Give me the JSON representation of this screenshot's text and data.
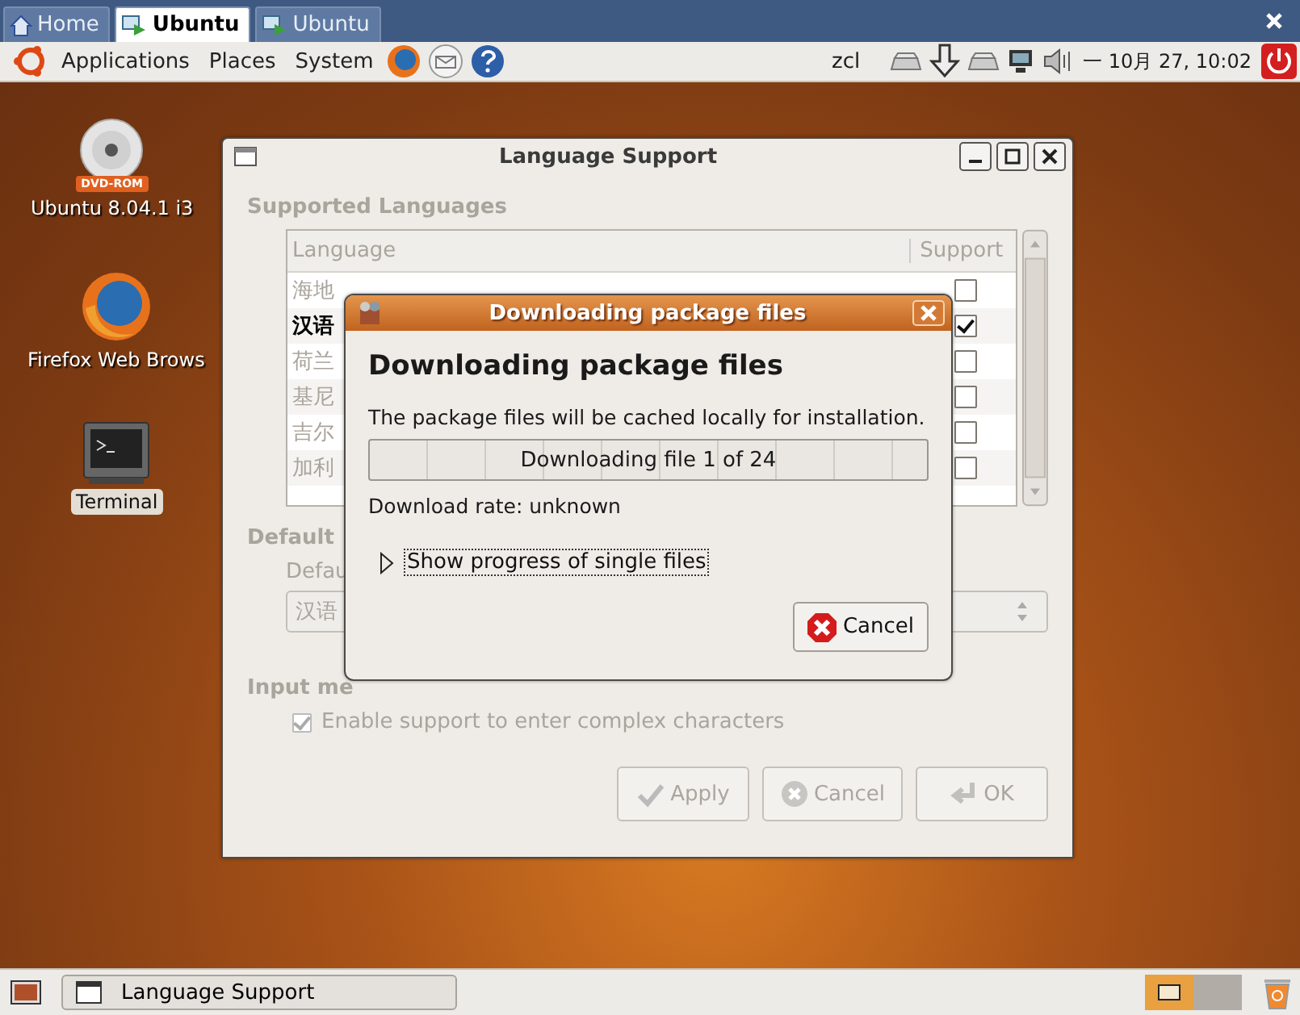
{
  "top_panel": {
    "tabs": [
      {
        "label": "Home",
        "selected": false
      },
      {
        "label": "Ubuntu",
        "selected": true
      },
      {
        "label": "Ubuntu",
        "selected": false
      }
    ],
    "menus": [
      "Applications",
      "Places",
      "System"
    ],
    "user": "zcl",
    "clock": "一 10月 27, 10:02"
  },
  "desktop_icons": [
    {
      "label": "Ubuntu 8.04.1 i3",
      "kind": "dvd",
      "badge": "DVD-ROM",
      "selected": false
    },
    {
      "label": "Firefox Web Brows",
      "kind": "firefox",
      "selected": false
    },
    {
      "label": "Terminal",
      "kind": "terminal",
      "selected": true
    }
  ],
  "language_window": {
    "title": "Language Support",
    "disabled": true,
    "supported_heading": "Supported Languages",
    "columns": [
      "Language",
      "Support"
    ],
    "rows": [
      {
        "name": "海地",
        "current": false,
        "checked": false
      },
      {
        "name": "汉语",
        "current": true,
        "checked": true
      },
      {
        "name": "荷兰",
        "current": false,
        "checked": false
      },
      {
        "name": "基尼",
        "current": false,
        "checked": false
      },
      {
        "name": "吉尔",
        "current": false,
        "checked": false
      },
      {
        "name": "加利",
        "current": false,
        "checked": false
      }
    ],
    "default_heading": "Default",
    "default_label": "Defau",
    "default_value": "汉语",
    "input_heading": "Input me",
    "input_option": {
      "label": "Enable support to enter complex characters",
      "checked": true
    },
    "buttons": [
      {
        "label": "Apply",
        "kind": "apply",
        "disabled": true
      },
      {
        "label": "Cancel",
        "kind": "cancel",
        "disabled": true
      },
      {
        "label": "OK",
        "kind": "ok",
        "disabled": true
      }
    ]
  },
  "download_dialog": {
    "title": "Downloading package files",
    "heading": "Downloading package files",
    "message": "The package files will be cached locally for installation.",
    "progress": {
      "level": 0,
      "text": "Downloading file 1 of 24"
    },
    "rate": "Download rate: unknown",
    "expander": {
      "label": "Show progress of single files",
      "expanded": false
    },
    "cancel": "Cancel"
  },
  "bottom_panel": {
    "task": "Language Support",
    "workspaces": [
      {
        "selected": true
      },
      {
        "selected": false
      }
    ]
  }
}
